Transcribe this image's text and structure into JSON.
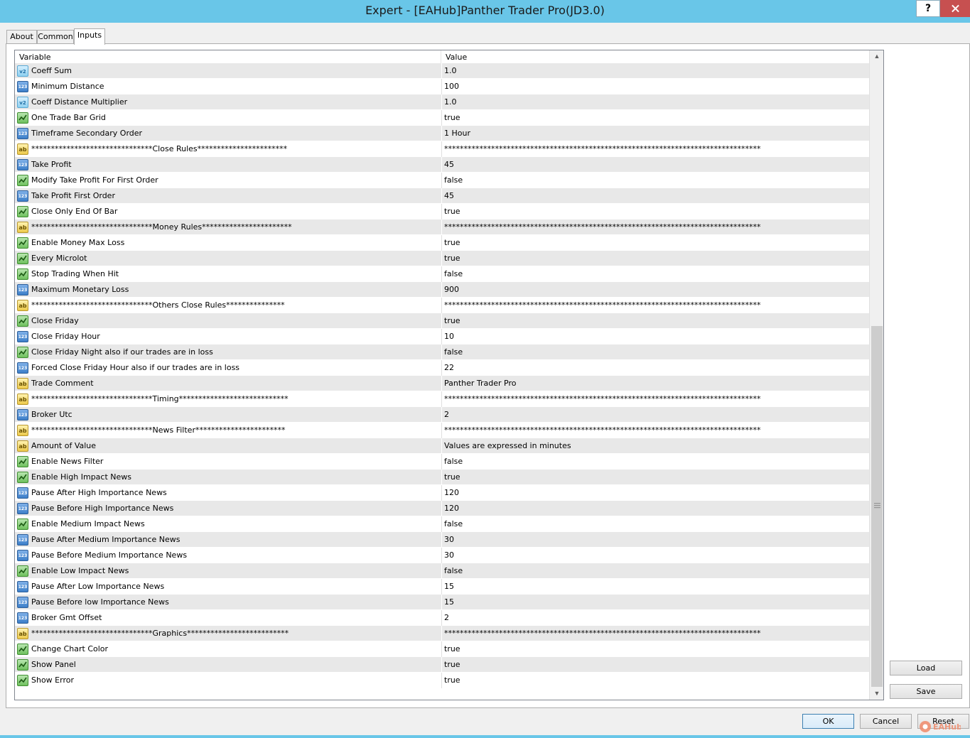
{
  "window": {
    "title": "Expert - [EAHub]Panther Trader Pro(JD3.0)",
    "help_label": "?"
  },
  "tabs": [
    {
      "label": "About"
    },
    {
      "label": "Common"
    },
    {
      "label": "Inputs"
    }
  ],
  "grid": {
    "headers": {
      "variable": "Variable",
      "value": "Value"
    },
    "rows": [
      {
        "type": "double",
        "variable": "Coeff Sum",
        "value": "1.0"
      },
      {
        "type": "int",
        "variable": "Minimum Distance",
        "value": "100"
      },
      {
        "type": "double",
        "variable": "Coeff Distance Multiplier",
        "value": "1.0"
      },
      {
        "type": "bool",
        "variable": "One Trade Bar Grid",
        "value": "true"
      },
      {
        "type": "int",
        "variable": "Timeframe Secondary Order",
        "value": "1 Hour"
      },
      {
        "type": "string",
        "variable": "*******************************Close Rules***********************",
        "value": "*********************************************************************************"
      },
      {
        "type": "int",
        "variable": "Take Profit",
        "value": "45"
      },
      {
        "type": "bool",
        "variable": "Modify Take Profit For First Order",
        "value": "false"
      },
      {
        "type": "int",
        "variable": "Take Profit First Order",
        "value": "45"
      },
      {
        "type": "bool",
        "variable": "Close Only End Of Bar",
        "value": "true"
      },
      {
        "type": "string",
        "variable": "*******************************Money Rules***********************",
        "value": "*********************************************************************************"
      },
      {
        "type": "bool",
        "variable": "Enable Money Max Loss",
        "value": "true"
      },
      {
        "type": "bool",
        "variable": "Every Microlot",
        "value": "true"
      },
      {
        "type": "bool",
        "variable": "Stop Trading When Hit",
        "value": "false"
      },
      {
        "type": "int",
        "variable": "Maximum Monetary Loss",
        "value": "900"
      },
      {
        "type": "string",
        "variable": "*******************************Others Close Rules***************",
        "value": "*********************************************************************************"
      },
      {
        "type": "bool",
        "variable": "Close Friday",
        "value": "true"
      },
      {
        "type": "int",
        "variable": "Close Friday Hour",
        "value": "10"
      },
      {
        "type": "bool",
        "variable": "Close Friday Night also if our trades are in loss",
        "value": "false"
      },
      {
        "type": "int",
        "variable": "Forced Close Friday Hour also if our trades are in loss",
        "value": "22"
      },
      {
        "type": "string",
        "variable": "Trade Comment",
        "value": "Panther Trader Pro"
      },
      {
        "type": "string",
        "variable": "*******************************Timing****************************",
        "value": "*********************************************************************************"
      },
      {
        "type": "int",
        "variable": "Broker Utc",
        "value": "2"
      },
      {
        "type": "string",
        "variable": "*******************************News Filter***********************",
        "value": "*********************************************************************************"
      },
      {
        "type": "string",
        "variable": "Amount of Value",
        "value": "Values are expressed in minutes"
      },
      {
        "type": "bool",
        "variable": "Enable News Filter",
        "value": "false"
      },
      {
        "type": "bool",
        "variable": "Enable High Impact News",
        "value": "true"
      },
      {
        "type": "int",
        "variable": "Pause After High Importance News",
        "value": "120"
      },
      {
        "type": "int",
        "variable": "Pause Before High Importance News",
        "value": "120"
      },
      {
        "type": "bool",
        "variable": "Enable Medium Impact News",
        "value": "false"
      },
      {
        "type": "int",
        "variable": "Pause After Medium Importance News",
        "value": "30"
      },
      {
        "type": "int",
        "variable": "Pause Before Medium Importance News",
        "value": "30"
      },
      {
        "type": "bool",
        "variable": "Enable Low Impact News",
        "value": "false"
      },
      {
        "type": "int",
        "variable": "Pause After Low Importance News",
        "value": "15"
      },
      {
        "type": "int",
        "variable": "Pause Before low Importance News",
        "value": "15"
      },
      {
        "type": "int",
        "variable": "Broker Gmt Offset",
        "value": "2"
      },
      {
        "type": "string",
        "variable": "*******************************Graphics**************************",
        "value": "*********************************************************************************"
      },
      {
        "type": "bool",
        "variable": "Change Chart Color",
        "value": "true"
      },
      {
        "type": "bool",
        "variable": "Show Panel",
        "value": "true"
      },
      {
        "type": "bool",
        "variable": "Show Error",
        "value": "true"
      }
    ]
  },
  "side_buttons": {
    "load": "Load",
    "save": "Save"
  },
  "footer_buttons": {
    "ok": "OK",
    "cancel": "Cancel",
    "reset": "Reset"
  },
  "icons": {
    "double": "v2",
    "int": "123",
    "string": "ab",
    "bool": "bool-chart-icon"
  },
  "watermark": "EAHub",
  "colors": {
    "titlebar": "#69c6e8",
    "close_button": "#c75050",
    "row_alt": "#e8e8e8"
  }
}
